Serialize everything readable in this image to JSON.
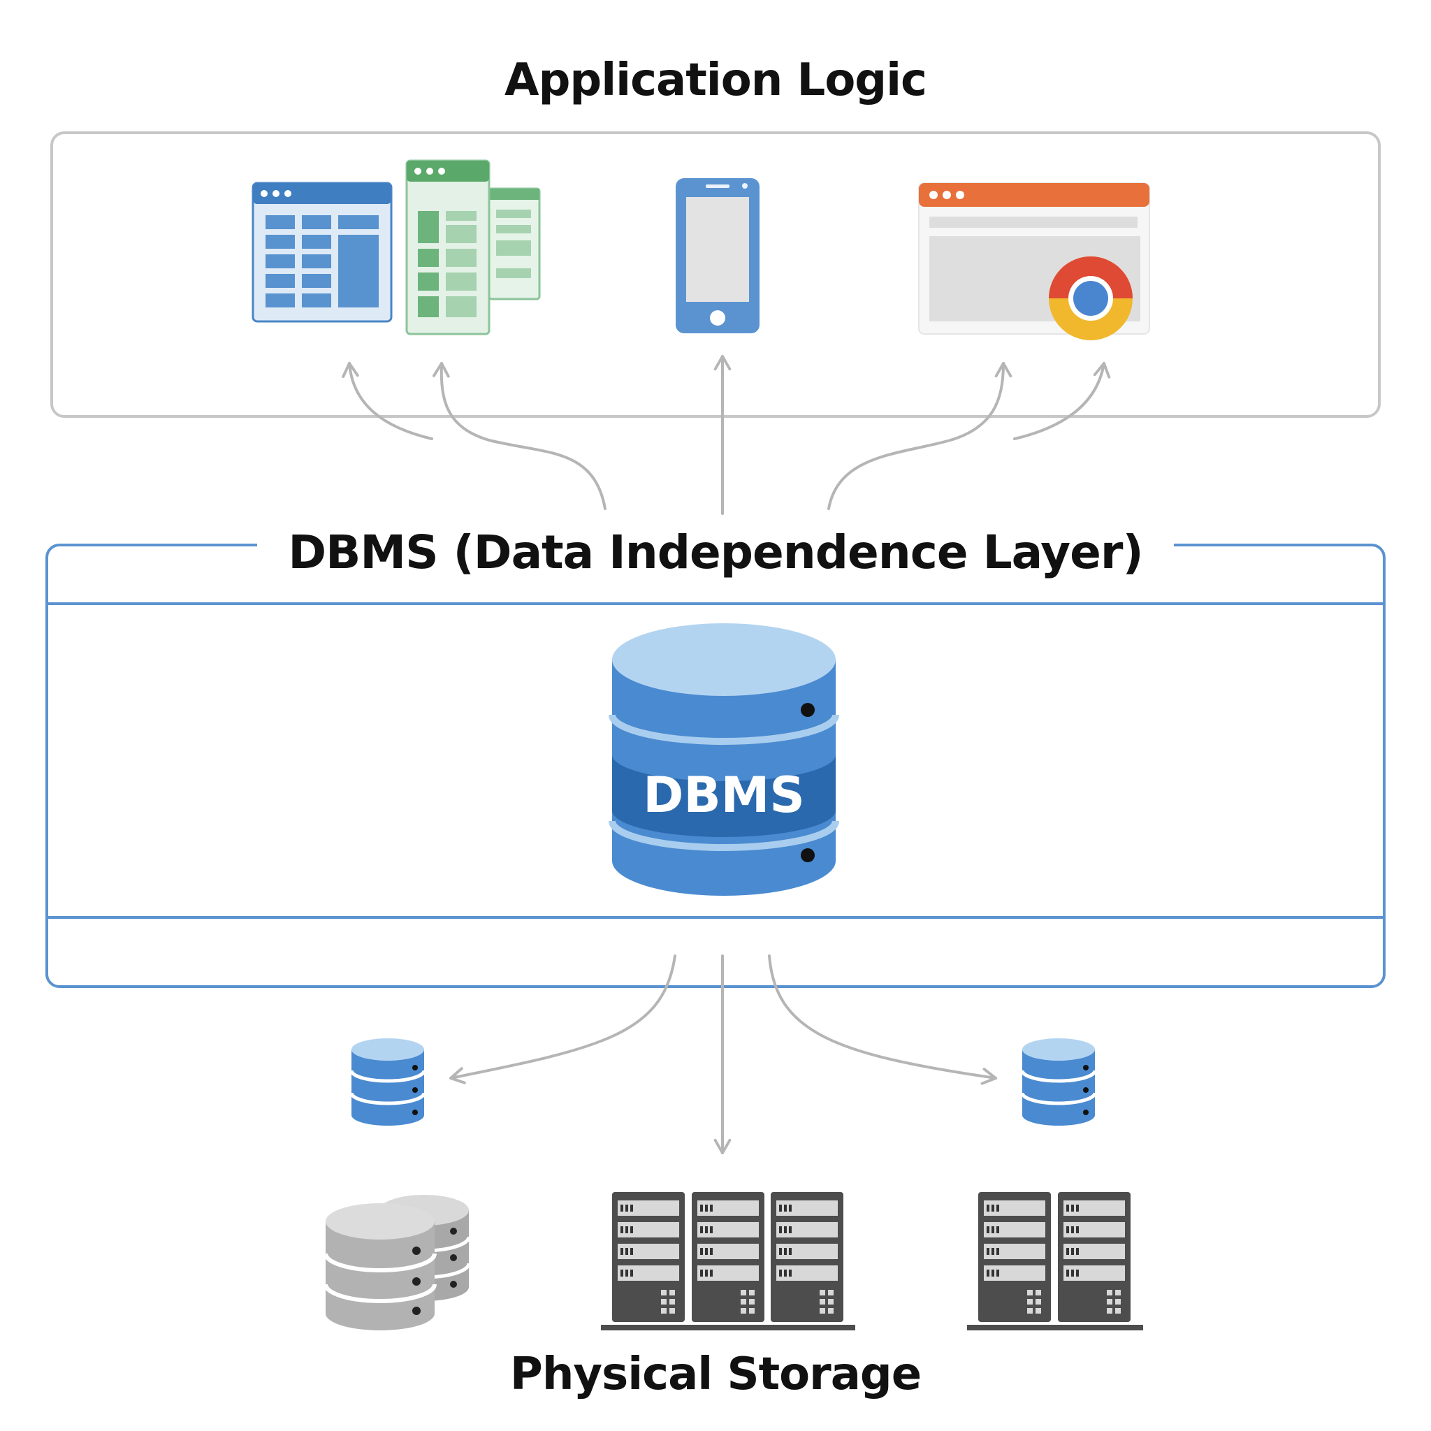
{
  "diagram": {
    "application_layer": {
      "title": "Application Logic",
      "apps": [
        "spreadsheet-app-icon",
        "spreadsheet-app-icon",
        "mobile-phone-icon",
        "web-browser-icon"
      ]
    },
    "dbms_layer": {
      "title": "DBMS (Data Independence Layer)",
      "database_label": "DBMS"
    },
    "storage_layer": {
      "title": "Physical Storage"
    },
    "colors": {
      "blue": "#3f7fc1",
      "blue_light": "#a9cdee",
      "green": "#5aa86a",
      "orange": "#e8703a",
      "gray_line": "#b5b5b5",
      "server": "#4d4d4d"
    }
  }
}
